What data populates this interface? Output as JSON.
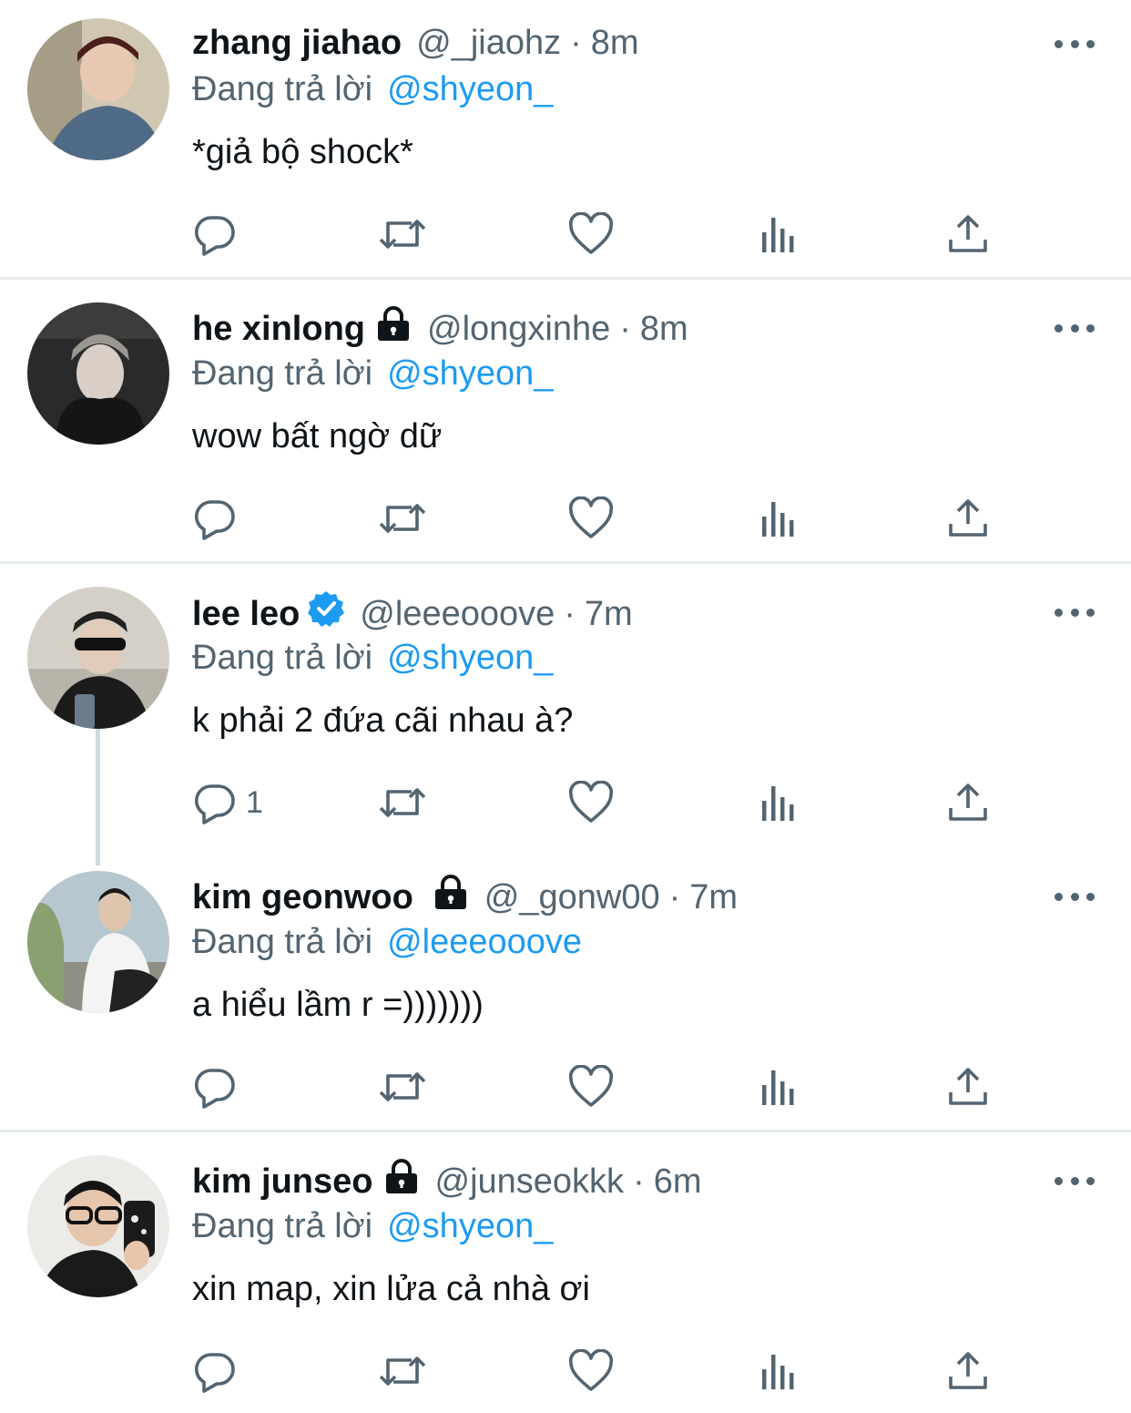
{
  "reply_prefix": "Đang trả lời",
  "colors": {
    "link": "#1d9bf0",
    "secondary": "#536471",
    "verified": "#1d9bf0",
    "divider": "#e6ecf0"
  },
  "tweets": [
    {
      "name": "zhang jiahao",
      "locked": false,
      "verified": false,
      "handle": "@_jiaohz",
      "separator": "·",
      "time": "8m",
      "replying_to": "@shyeon_",
      "text": "*giả bộ shock*",
      "reply_count": "",
      "avatar": "photo-avatar"
    },
    {
      "name": "he xinlong",
      "locked": true,
      "verified": false,
      "handle": "@longxinhe",
      "separator": "·",
      "time": "8m",
      "replying_to": "@shyeon_",
      "text": "wow bất ngờ dữ",
      "reply_count": "",
      "avatar": "photo-avatar"
    },
    {
      "name": "lee leo",
      "locked": false,
      "verified": true,
      "handle": "@leeeooove",
      "separator": "·",
      "time": "7m",
      "replying_to": "@shyeon_",
      "text": "k phải 2 đứa cãi nhau à?",
      "reply_count": "1",
      "avatar": "photo-avatar"
    },
    {
      "name": "kim geonwoo",
      "locked": true,
      "verified": false,
      "handle": "@_gonw00",
      "separator": "·",
      "time": "7m",
      "replying_to": "@leeeooove",
      "text": "a hiểu lầm r =)))))))",
      "reply_count": "",
      "avatar": "photo-avatar"
    },
    {
      "name": "kim junseo",
      "locked": true,
      "verified": false,
      "handle": "@junseokkk",
      "separator": "·",
      "time": "6m",
      "replying_to": "@shyeon_",
      "text": "xin map, xin lửa cả nhà ơi",
      "reply_count": "",
      "avatar": "photo-avatar"
    }
  ],
  "action_icons": [
    "reply-icon",
    "retweet-icon",
    "like-icon",
    "views-icon",
    "share-icon"
  ]
}
